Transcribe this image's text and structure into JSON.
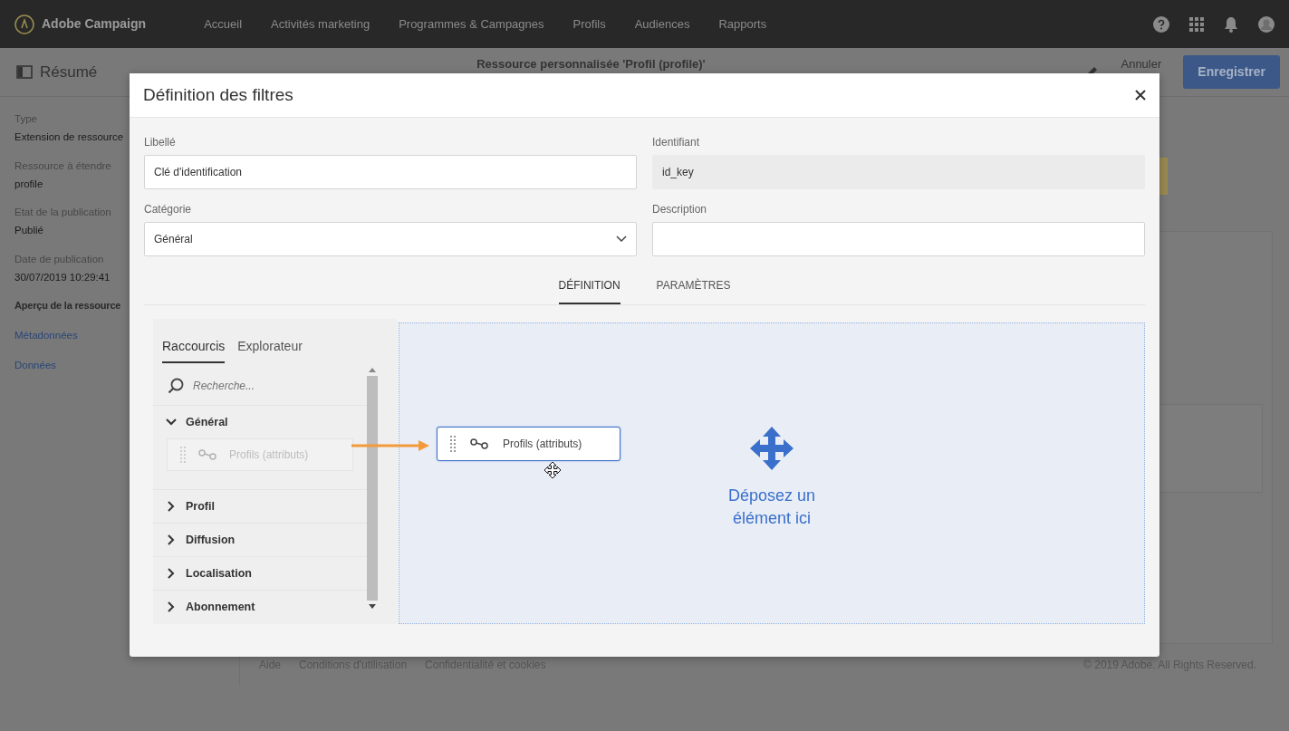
{
  "app": {
    "name": "Adobe Campaign"
  },
  "nav": [
    {
      "label": "Accueil"
    },
    {
      "label": "Activités marketing"
    },
    {
      "label": "Programmes & Campagnes"
    },
    {
      "label": "Profils"
    },
    {
      "label": "Audiences"
    },
    {
      "label": "Rapports"
    }
  ],
  "page_header": {
    "title": "Résumé",
    "resource_title": "Ressource personnalisée 'Profil (profile)'",
    "cancel": "Annuler",
    "save": "Enregistrer"
  },
  "summary": [
    {
      "label": "Type",
      "value": "Extension de ressource"
    },
    {
      "label": "Ressource à étendre",
      "value": "profile"
    },
    {
      "label": "Etat de la publication",
      "value": "Publié"
    },
    {
      "label": "Date de publication",
      "value": "30/07/2019 10:29:41"
    }
  ],
  "summary_heading": "Aperçu de la ressource",
  "summary_links": [
    {
      "label": "Métadonnées"
    },
    {
      "label": "Données"
    }
  ],
  "footer": {
    "links": [
      {
        "label": "Aide"
      },
      {
        "label": "Conditions d'utilisation"
      },
      {
        "label": "Confidentialité et cookies"
      }
    ],
    "copyright": "© 2019 Adobe. All Rights Reserved."
  },
  "dialog": {
    "title": "Définition des filtres",
    "fields": [
      {
        "label": "Libellé",
        "kind": "text",
        "value": "Clé d'identification",
        "disabled": false
      },
      {
        "label": "Identifiant",
        "kind": "text",
        "value": "id_key",
        "disabled": true
      },
      {
        "label": "Catégorie",
        "kind": "select",
        "value": "Général",
        "disabled": false
      },
      {
        "label": "Description",
        "kind": "text",
        "disabled": false
      }
    ],
    "tabs": [
      {
        "label": "DÉFINITION",
        "selected": true
      },
      {
        "label": "PARAMÈTRES",
        "selected": false
      }
    ],
    "palette": {
      "tabs": [
        {
          "label": "Raccourcis",
          "selected": true
        },
        {
          "label": "Explorateur",
          "selected": false
        }
      ],
      "search": {
        "placeholder": "Recherche..."
      },
      "groups": [
        {
          "label": "Général",
          "expanded": true,
          "children": [
            {
              "label": "Profils (attributs)",
              "dragging": true
            }
          ]
        },
        {
          "label": "Profil",
          "expanded": false
        },
        {
          "label": "Diffusion",
          "expanded": false
        },
        {
          "label": "Localisation",
          "expanded": false
        },
        {
          "label": "Abonnement",
          "expanded": false
        }
      ]
    },
    "canvas": {
      "dragged_item": {
        "label": "Profils (attributs)"
      },
      "drop_hint": "Déposez un élément ici"
    }
  }
}
